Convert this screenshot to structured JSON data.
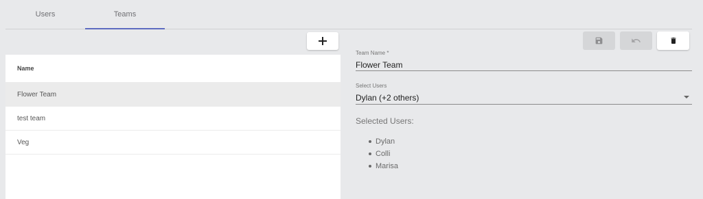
{
  "tabs": [
    {
      "label": "Users",
      "active": false
    },
    {
      "label": "Teams",
      "active": true
    }
  ],
  "teams_table": {
    "header": "Name",
    "rows": [
      "Flower Team",
      "test team",
      "Veg"
    ],
    "selected_index": 0
  },
  "toolbar": {
    "add_icon": "plus-icon",
    "save_icon": "save-icon",
    "undo_icon": "undo-icon",
    "delete_icon": "trash-icon"
  },
  "form": {
    "team_name_label": "Team Name *",
    "team_name_value": "Flower Team",
    "select_users_label": "Select Users",
    "select_users_value": "Dylan (+2 others)",
    "selected_users_title": "Selected Users:",
    "selected_users": [
      "Dylan",
      "Colli",
      "Marisa"
    ]
  },
  "colors": {
    "accent": "#5c6bc0",
    "background": "#e8e9eb",
    "disabled_button": "#d5d6d8"
  }
}
